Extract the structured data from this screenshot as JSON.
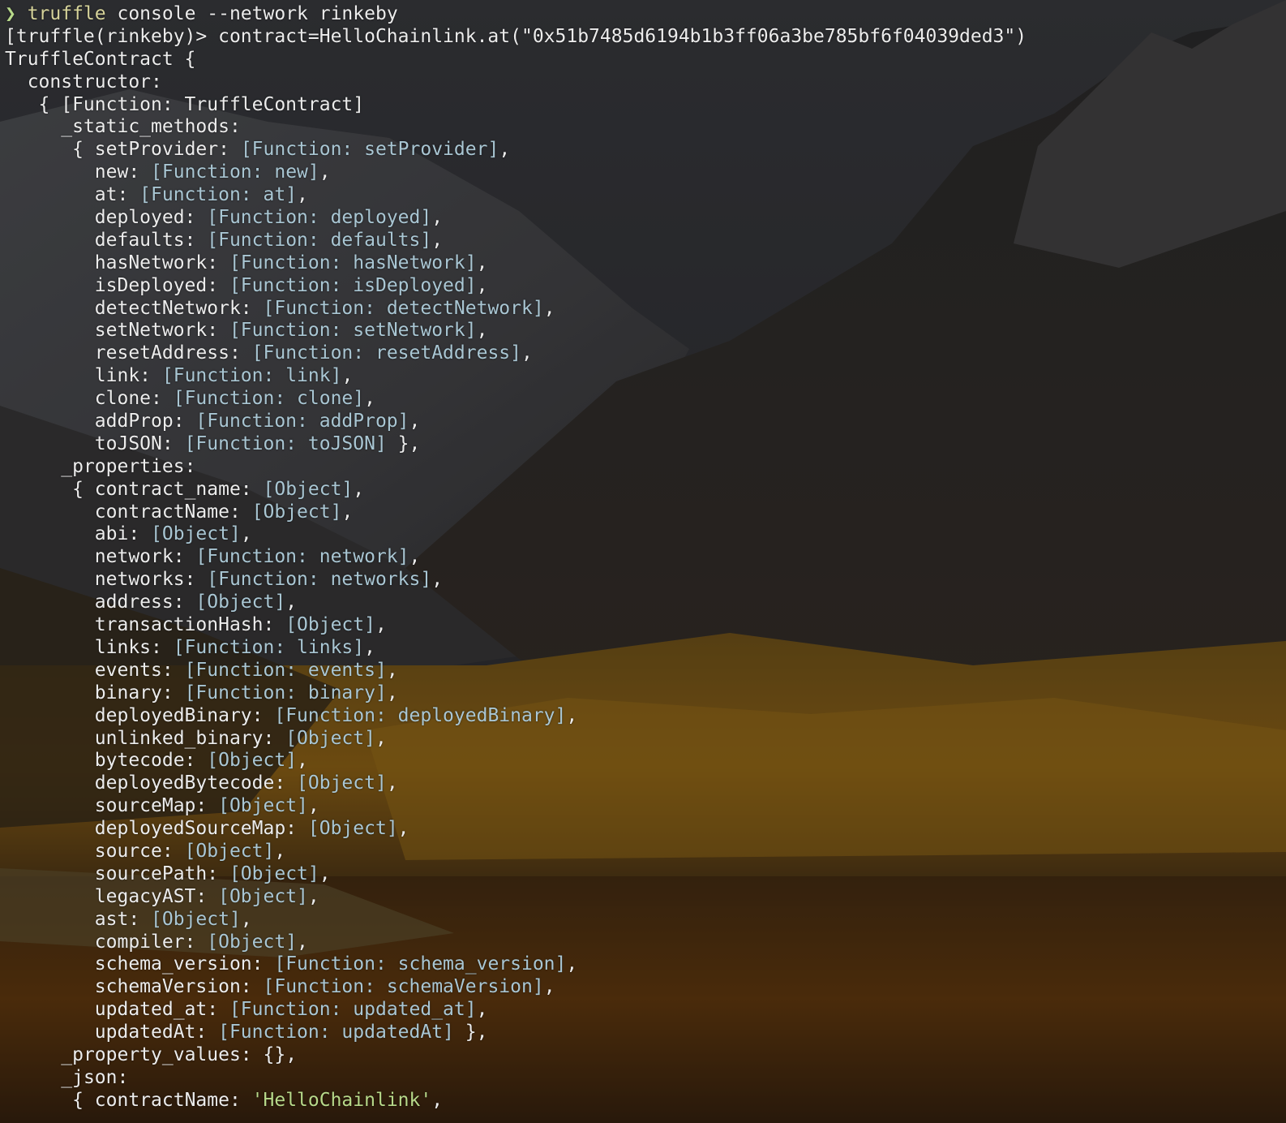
{
  "colors": {
    "key_text": "#ececec",
    "value_text": "#a9c6d3",
    "string_text": "#b7d98a",
    "prompt_arrow": "#b7d98a",
    "command_text": "#d6d39a"
  },
  "terminal": {
    "lines": [
      {
        "indent": "",
        "parts": [
          {
            "t": "❯ ",
            "c": "prompt-arrow"
          },
          {
            "t": "truffle",
            "c": "cmd"
          },
          {
            "t": " console --network rinkeby",
            "c": "k"
          }
        ]
      },
      {
        "indent": "",
        "parts": [
          {
            "t": "[truffle(rinkeby)> contract=HelloChainlink.at(\"0x51b7485d6194b1b3ff06a3be785bf6f04039ded3\")",
            "c": "k"
          }
        ]
      },
      {
        "indent": "",
        "parts": [
          {
            "t": "TruffleContract {",
            "c": "k"
          }
        ]
      },
      {
        "indent": "  ",
        "parts": [
          {
            "t": "constructor:",
            "c": "k"
          }
        ]
      },
      {
        "indent": "   ",
        "parts": [
          {
            "t": "{ [Function: TruffleContract]",
            "c": "k"
          }
        ]
      },
      {
        "indent": "     ",
        "parts": [
          {
            "t": "_static_methods:",
            "c": "k"
          }
        ]
      },
      {
        "indent": "      ",
        "parts": [
          {
            "t": "{ setProvider: ",
            "c": "k"
          },
          {
            "t": "[Function: setProvider]",
            "c": "v"
          },
          {
            "t": ",",
            "c": "k"
          }
        ]
      },
      {
        "indent": "        ",
        "parts": [
          {
            "t": "new: ",
            "c": "k"
          },
          {
            "t": "[Function: new]",
            "c": "v"
          },
          {
            "t": ",",
            "c": "k"
          }
        ]
      },
      {
        "indent": "        ",
        "parts": [
          {
            "t": "at: ",
            "c": "k"
          },
          {
            "t": "[Function: at]",
            "c": "v"
          },
          {
            "t": ",",
            "c": "k"
          }
        ]
      },
      {
        "indent": "        ",
        "parts": [
          {
            "t": "deployed: ",
            "c": "k"
          },
          {
            "t": "[Function: deployed]",
            "c": "v"
          },
          {
            "t": ",",
            "c": "k"
          }
        ]
      },
      {
        "indent": "        ",
        "parts": [
          {
            "t": "defaults: ",
            "c": "k"
          },
          {
            "t": "[Function: defaults]",
            "c": "v"
          },
          {
            "t": ",",
            "c": "k"
          }
        ]
      },
      {
        "indent": "        ",
        "parts": [
          {
            "t": "hasNetwork: ",
            "c": "k"
          },
          {
            "t": "[Function: hasNetwork]",
            "c": "v"
          },
          {
            "t": ",",
            "c": "k"
          }
        ]
      },
      {
        "indent": "        ",
        "parts": [
          {
            "t": "isDeployed: ",
            "c": "k"
          },
          {
            "t": "[Function: isDeployed]",
            "c": "v"
          },
          {
            "t": ",",
            "c": "k"
          }
        ]
      },
      {
        "indent": "        ",
        "parts": [
          {
            "t": "detectNetwork: ",
            "c": "k"
          },
          {
            "t": "[Function: detectNetwork]",
            "c": "v"
          },
          {
            "t": ",",
            "c": "k"
          }
        ]
      },
      {
        "indent": "        ",
        "parts": [
          {
            "t": "setNetwork: ",
            "c": "k"
          },
          {
            "t": "[Function: setNetwork]",
            "c": "v"
          },
          {
            "t": ",",
            "c": "k"
          }
        ]
      },
      {
        "indent": "        ",
        "parts": [
          {
            "t": "resetAddress: ",
            "c": "k"
          },
          {
            "t": "[Function: resetAddress]",
            "c": "v"
          },
          {
            "t": ",",
            "c": "k"
          }
        ]
      },
      {
        "indent": "        ",
        "parts": [
          {
            "t": "link: ",
            "c": "k"
          },
          {
            "t": "[Function: link]",
            "c": "v"
          },
          {
            "t": ",",
            "c": "k"
          }
        ]
      },
      {
        "indent": "        ",
        "parts": [
          {
            "t": "clone: ",
            "c": "k"
          },
          {
            "t": "[Function: clone]",
            "c": "v"
          },
          {
            "t": ",",
            "c": "k"
          }
        ]
      },
      {
        "indent": "        ",
        "parts": [
          {
            "t": "addProp: ",
            "c": "k"
          },
          {
            "t": "[Function: addProp]",
            "c": "v"
          },
          {
            "t": ",",
            "c": "k"
          }
        ]
      },
      {
        "indent": "        ",
        "parts": [
          {
            "t": "toJSON: ",
            "c": "k"
          },
          {
            "t": "[Function: toJSON]",
            "c": "v"
          },
          {
            "t": " },",
            "c": "k"
          }
        ]
      },
      {
        "indent": "     ",
        "parts": [
          {
            "t": "_properties:",
            "c": "k"
          }
        ]
      },
      {
        "indent": "      ",
        "parts": [
          {
            "t": "{ contract_name: ",
            "c": "k"
          },
          {
            "t": "[Object]",
            "c": "v"
          },
          {
            "t": ",",
            "c": "k"
          }
        ]
      },
      {
        "indent": "        ",
        "parts": [
          {
            "t": "contractName: ",
            "c": "k"
          },
          {
            "t": "[Object]",
            "c": "v"
          },
          {
            "t": ",",
            "c": "k"
          }
        ]
      },
      {
        "indent": "        ",
        "parts": [
          {
            "t": "abi: ",
            "c": "k"
          },
          {
            "t": "[Object]",
            "c": "v"
          },
          {
            "t": ",",
            "c": "k"
          }
        ]
      },
      {
        "indent": "        ",
        "parts": [
          {
            "t": "network: ",
            "c": "k"
          },
          {
            "t": "[Function: network]",
            "c": "v"
          },
          {
            "t": ",",
            "c": "k"
          }
        ]
      },
      {
        "indent": "        ",
        "parts": [
          {
            "t": "networks: ",
            "c": "k"
          },
          {
            "t": "[Function: networks]",
            "c": "v"
          },
          {
            "t": ",",
            "c": "k"
          }
        ]
      },
      {
        "indent": "        ",
        "parts": [
          {
            "t": "address: ",
            "c": "k"
          },
          {
            "t": "[Object]",
            "c": "v"
          },
          {
            "t": ",",
            "c": "k"
          }
        ]
      },
      {
        "indent": "        ",
        "parts": [
          {
            "t": "transactionHash: ",
            "c": "k"
          },
          {
            "t": "[Object]",
            "c": "v"
          },
          {
            "t": ",",
            "c": "k"
          }
        ]
      },
      {
        "indent": "        ",
        "parts": [
          {
            "t": "links: ",
            "c": "k"
          },
          {
            "t": "[Function: links]",
            "c": "v"
          },
          {
            "t": ",",
            "c": "k"
          }
        ]
      },
      {
        "indent": "        ",
        "parts": [
          {
            "t": "events: ",
            "c": "k"
          },
          {
            "t": "[Function: events]",
            "c": "v"
          },
          {
            "t": ",",
            "c": "k"
          }
        ]
      },
      {
        "indent": "        ",
        "parts": [
          {
            "t": "binary: ",
            "c": "k"
          },
          {
            "t": "[Function: binary]",
            "c": "v"
          },
          {
            "t": ",",
            "c": "k"
          }
        ]
      },
      {
        "indent": "        ",
        "parts": [
          {
            "t": "deployedBinary: ",
            "c": "k"
          },
          {
            "t": "[Function: deployedBinary]",
            "c": "v"
          },
          {
            "t": ",",
            "c": "k"
          }
        ]
      },
      {
        "indent": "        ",
        "parts": [
          {
            "t": "unlinked_binary: ",
            "c": "k"
          },
          {
            "t": "[Object]",
            "c": "v"
          },
          {
            "t": ",",
            "c": "k"
          }
        ]
      },
      {
        "indent": "        ",
        "parts": [
          {
            "t": "bytecode: ",
            "c": "k"
          },
          {
            "t": "[Object]",
            "c": "v"
          },
          {
            "t": ",",
            "c": "k"
          }
        ]
      },
      {
        "indent": "        ",
        "parts": [
          {
            "t": "deployedBytecode: ",
            "c": "k"
          },
          {
            "t": "[Object]",
            "c": "v"
          },
          {
            "t": ",",
            "c": "k"
          }
        ]
      },
      {
        "indent": "        ",
        "parts": [
          {
            "t": "sourceMap: ",
            "c": "k"
          },
          {
            "t": "[Object]",
            "c": "v"
          },
          {
            "t": ",",
            "c": "k"
          }
        ]
      },
      {
        "indent": "        ",
        "parts": [
          {
            "t": "deployedSourceMap: ",
            "c": "k"
          },
          {
            "t": "[Object]",
            "c": "v"
          },
          {
            "t": ",",
            "c": "k"
          }
        ]
      },
      {
        "indent": "        ",
        "parts": [
          {
            "t": "source: ",
            "c": "k"
          },
          {
            "t": "[Object]",
            "c": "v"
          },
          {
            "t": ",",
            "c": "k"
          }
        ]
      },
      {
        "indent": "        ",
        "parts": [
          {
            "t": "sourcePath: ",
            "c": "k"
          },
          {
            "t": "[Object]",
            "c": "v"
          },
          {
            "t": ",",
            "c": "k"
          }
        ]
      },
      {
        "indent": "        ",
        "parts": [
          {
            "t": "legacyAST: ",
            "c": "k"
          },
          {
            "t": "[Object]",
            "c": "v"
          },
          {
            "t": ",",
            "c": "k"
          }
        ]
      },
      {
        "indent": "        ",
        "parts": [
          {
            "t": "ast: ",
            "c": "k"
          },
          {
            "t": "[Object]",
            "c": "v"
          },
          {
            "t": ",",
            "c": "k"
          }
        ]
      },
      {
        "indent": "        ",
        "parts": [
          {
            "t": "compiler: ",
            "c": "k"
          },
          {
            "t": "[Object]",
            "c": "v"
          },
          {
            "t": ",",
            "c": "k"
          }
        ]
      },
      {
        "indent": "        ",
        "parts": [
          {
            "t": "schema_version: ",
            "c": "k"
          },
          {
            "t": "[Function: schema_version]",
            "c": "v"
          },
          {
            "t": ",",
            "c": "k"
          }
        ]
      },
      {
        "indent": "        ",
        "parts": [
          {
            "t": "schemaVersion: ",
            "c": "k"
          },
          {
            "t": "[Function: schemaVersion]",
            "c": "v"
          },
          {
            "t": ",",
            "c": "k"
          }
        ]
      },
      {
        "indent": "        ",
        "parts": [
          {
            "t": "updated_at: ",
            "c": "k"
          },
          {
            "t": "[Function: updated_at]",
            "c": "v"
          },
          {
            "t": ",",
            "c": "k"
          }
        ]
      },
      {
        "indent": "        ",
        "parts": [
          {
            "t": "updatedAt: ",
            "c": "k"
          },
          {
            "t": "[Function: updatedAt]",
            "c": "v"
          },
          {
            "t": " },",
            "c": "k"
          }
        ]
      },
      {
        "indent": "     ",
        "parts": [
          {
            "t": "_property_values: {},",
            "c": "k"
          }
        ]
      },
      {
        "indent": "     ",
        "parts": [
          {
            "t": "_json:",
            "c": "k"
          }
        ]
      },
      {
        "indent": "      ",
        "parts": [
          {
            "t": "{ contractName: ",
            "c": "k"
          },
          {
            "t": "'HelloChainlink'",
            "c": "s"
          },
          {
            "t": ",",
            "c": "k"
          }
        ]
      }
    ]
  }
}
